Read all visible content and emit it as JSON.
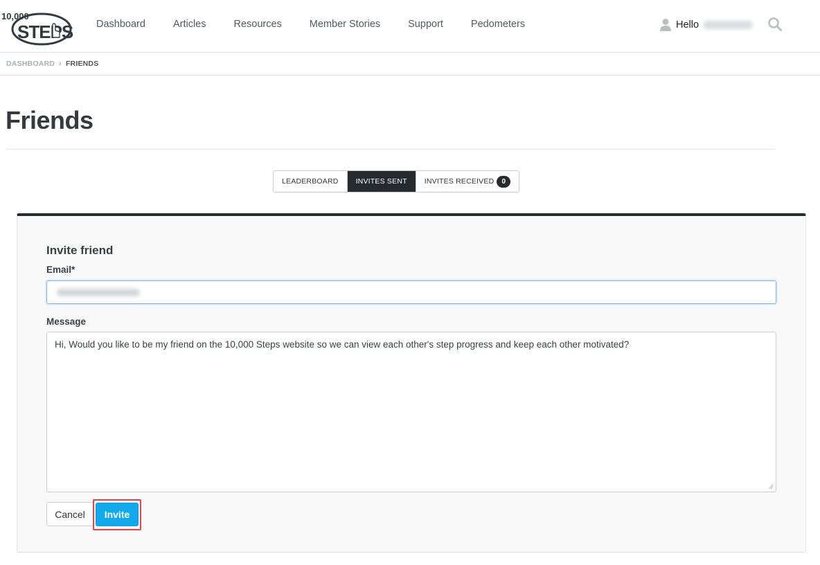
{
  "header": {
    "logo": {
      "number": "10,000",
      "word": "STEPS"
    },
    "nav": [
      {
        "label": "Dashboard"
      },
      {
        "label": "Articles"
      },
      {
        "label": "Resources"
      },
      {
        "label": "Member Stories"
      },
      {
        "label": "Support"
      },
      {
        "label": "Pedometers"
      }
    ],
    "greeting": "Hello",
    "icons": {
      "user": "user-icon",
      "search": "search-icon"
    }
  },
  "breadcrumb": {
    "root": "DASHBOARD",
    "separator_icon": "chevron-right-icon",
    "current": "FRIENDS"
  },
  "page": {
    "title": "Friends"
  },
  "tabs": {
    "items": [
      {
        "label": "LEADERBOARD",
        "active": false
      },
      {
        "label": "INVITES SENT",
        "active": true
      },
      {
        "label": "INVITES RECEIVED",
        "active": false,
        "badge": "0"
      }
    ]
  },
  "form": {
    "title": "Invite friend",
    "email_label": "Email*",
    "message_label": "Message",
    "message_value": "Hi, Would you like to be my friend on the 10,000 Steps website so we can view each other's step progress and keep each other motivated?",
    "cancel_label": "Cancel",
    "invite_label": "Invite"
  },
  "colors": {
    "accent": "#12a9ec",
    "dark": "#262b30",
    "highlight_border": "#e0434a"
  }
}
